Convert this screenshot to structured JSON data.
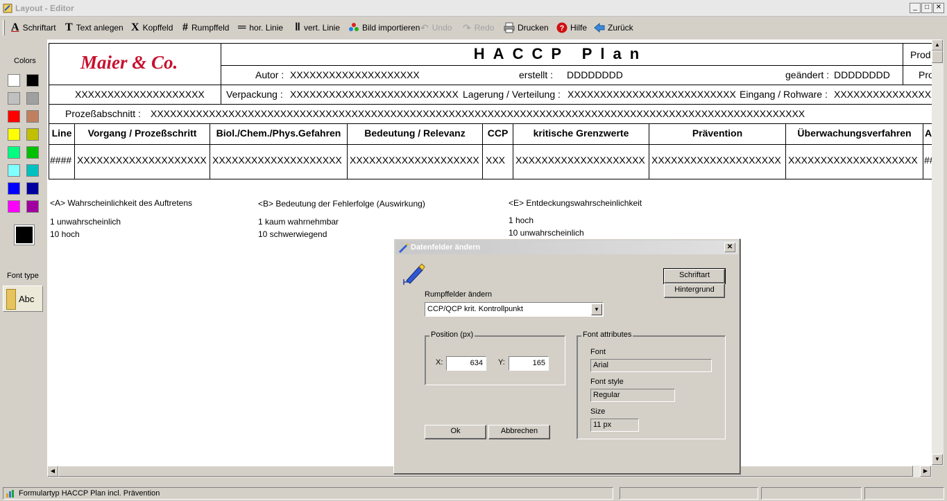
{
  "window": {
    "title": "Layout - Editor"
  },
  "toolbar": {
    "font": "Schriftart",
    "add_text": "Text anlegen",
    "header_field": "Kopffeld",
    "body_field": "Rumpffeld",
    "hor_line": "hor. Linie",
    "vert_line": "vert. Linie",
    "import_image": "Bild importieren",
    "undo": "Undo",
    "redo": "Redo",
    "print": "Drucken",
    "help": "Hilfe",
    "back": "Zurück"
  },
  "sidebar": {
    "colors_label": "Colors",
    "swatches": [
      "#ffffff",
      "#000000",
      "#c0c0c0",
      "#a0a0a0",
      "#ff0000",
      "#c08060",
      "#ffff00",
      "#c0c000",
      "#00ff80",
      "#00c000",
      "#80ffff",
      "#00c0c0",
      "#0000ff",
      "#0000a0",
      "#ff00ff",
      "#a000a0"
    ],
    "selected_color": "#000000",
    "font_type_label": "Font type",
    "font_type_sample": "Abc"
  },
  "canvas": {
    "logo": "Maier & Co.",
    "title": "HACCP Plan",
    "prod_1": "Prod",
    "prod_2": "Pro",
    "author_label": "Autor :",
    "author_value": "XXXXXXXXXXXXXXXXXXXX",
    "created_label": "erstellt :",
    "created_value": "DDDDDDDD",
    "changed_label": "geändert :",
    "changed_value": "DDDDDDDD",
    "row2_first": "XXXXXXXXXXXXXXXXXXXX",
    "packaging_label": "Verpackung :",
    "packaging_value": "XXXXXXXXXXXXXXXXXXXXXXXXXX",
    "storage_label": "Lagerung / Verteilung :",
    "storage_value": "XXXXXXXXXXXXXXXXXXXXXXXXXX",
    "intake_label": "Eingang / Rohware :",
    "intake_value": "XXXXXXXXXXXXXXXXX",
    "process_label": "Prozeßabschnitt :",
    "process_value": "XXXXXXXXXXXXXXXXXXXXXXXXXXXXXXXXXXXXXXXXXXXXXXXXXXXXXXXXXXXXXXXXXXXXXXXXXXXXXXXXXXXXXXXXXXXXXXXXXXXXX",
    "columns": [
      "Line",
      "Vorgang / Prozeßschritt",
      "Biol./Chem./Phys.Gefahren",
      "Bedeutung / Relevanz",
      "CCP",
      "kritische Grenzwerte",
      "Prävention",
      "Überwachungsverfahren",
      "A"
    ],
    "row_values": [
      "####",
      "XXXXXXXXXXXXXXXXXXXX",
      "XXXXXXXXXXXXXXXXXXXX",
      "XXXXXXXXXXXXXXXXXXXX",
      "XXX",
      "XXXXXXXXXXXXXXXXXXXX",
      "XXXXXXXXXXXXXXXXXXXX",
      "XXXXXXXXXXXXXXXXXXXX",
      "##"
    ],
    "legend_a_title": "<A> Wahrscheinlichkeit des Auftretens",
    "legend_a_1": "1 unwahrscheinlich",
    "legend_a_10": "10 hoch",
    "legend_b_title": "<B> Bedeutung der Fehlerfolge (Auswirkung)",
    "legend_b_1": "1 kaum wahrnehmbar",
    "legend_b_10": "10 schwerwiegend",
    "legend_e_title": "<E> Entdeckungswahrscheinlichkeit",
    "legend_e_1": "1 hoch",
    "legend_e_10": "10 unwahrscheinlich"
  },
  "statusbar": {
    "text": "Formulartyp HACCP Plan incl. Prävention"
  },
  "dialog": {
    "title": "Datenfelder ändern",
    "font_button": "Schriftart",
    "background_button": "Hintergrund",
    "select_label": "Rumpffelder ändern",
    "select_value": "CCP/QCP krit. Kontrollpunkt",
    "position_group": "Position (px)",
    "x_label": "X:",
    "x_value": "634",
    "y_label": "Y:",
    "y_value": "165",
    "font_attr_group": "Font attributes",
    "font_label": "Font",
    "font_value": "Arial",
    "style_label": "Font style",
    "style_value": "Regular",
    "size_label": "Size",
    "size_value": "11 px",
    "ok_button": "Ok",
    "cancel_button": "Abbrechen"
  }
}
